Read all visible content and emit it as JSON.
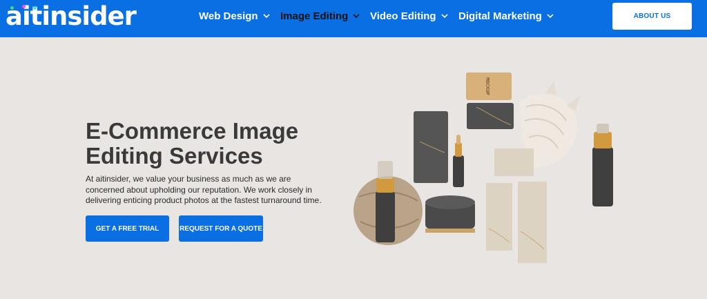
{
  "brand": {
    "name": "aitinsider"
  },
  "nav": {
    "items": [
      {
        "label": "Web Design"
      },
      {
        "label": "Image Editing"
      },
      {
        "label": "Video Editing"
      },
      {
        "label": "Digital Marketing"
      }
    ],
    "about_label": "ABOUT US"
  },
  "hero": {
    "title": "E-Commerce Image Editing Services",
    "text": "At aitinsider, we value your business as much as we are concerned about upholding our reputation. We work closely in delivering enticing product photos at the fastest turnaround time.",
    "trial_label": "GET A FREE TRIAL",
    "quote_label": "REQUEST FOR A QUOTE"
  },
  "mockup_text": "MOCKUP",
  "colors": {
    "brand_blue": "#0a6fe3",
    "hero_bg": "#e8e5e2",
    "title": "#3a3a3a"
  }
}
